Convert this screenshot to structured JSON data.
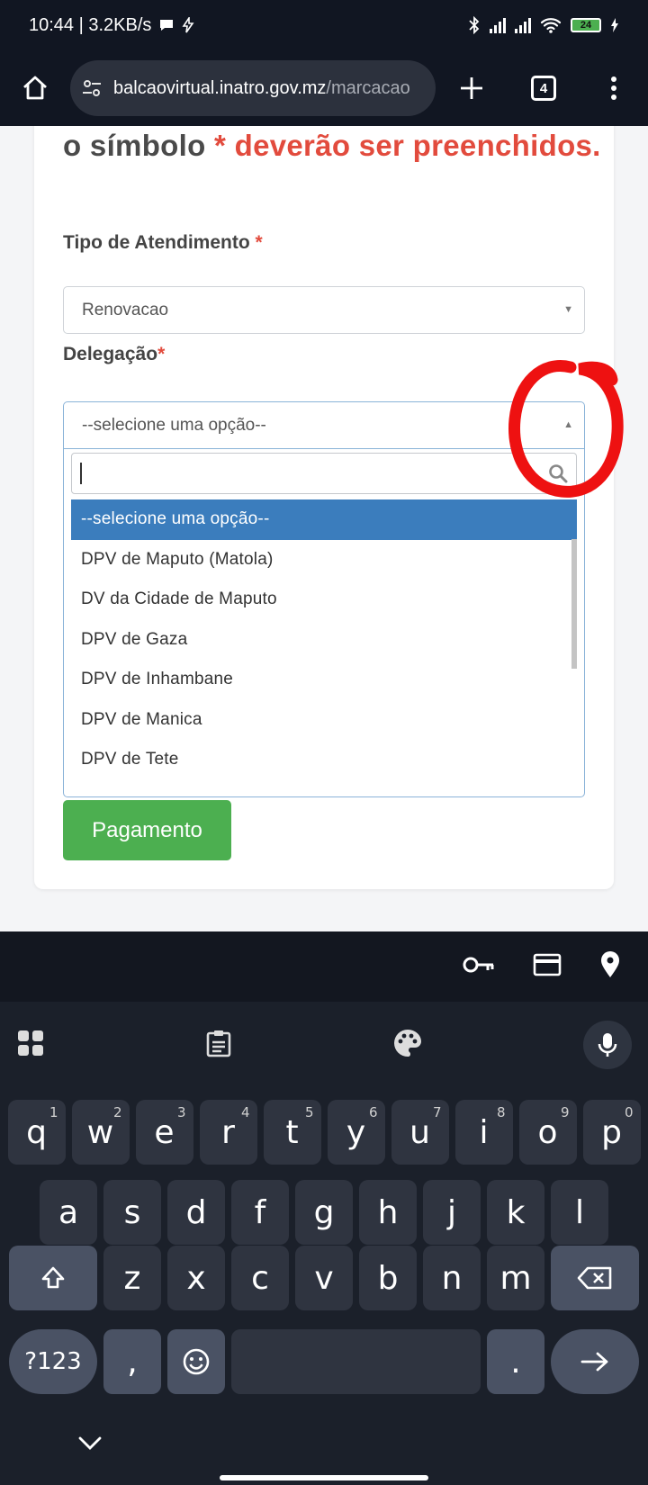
{
  "status_bar": {
    "time_speed": "10:44 | 3.2KB/s",
    "battery_level": "24"
  },
  "browser": {
    "url_host": "balcaovirtual.inatro.gov.mz",
    "url_path": "/marcacao",
    "tab_count": "4"
  },
  "form": {
    "notice_prefix": "o símbolo ",
    "notice_required": "* deverão ser preenchidos.",
    "tipo_label": "Tipo de Atendimento",
    "tipo_required_mark": "*",
    "tipo_value": "Renovacao",
    "delegacao_label": "Delegação",
    "delegacao_required_mark": "*",
    "delegacao_value": "--selecione uma opção--",
    "delegacao_options": [
      "--selecione uma opção--",
      "DPV de Maputo (Matola)",
      "DV da Cidade de Maputo",
      "DPV de Gaza",
      "DPV de Inhambane",
      "DPV de Manica",
      "DPV de Tete"
    ],
    "selected_option_index": 0,
    "submit_label": "Pagamento"
  },
  "keyboard": {
    "row1": [
      {
        "key": "q",
        "hint": "1"
      },
      {
        "key": "w",
        "hint": "2"
      },
      {
        "key": "e",
        "hint": "3"
      },
      {
        "key": "r",
        "hint": "4"
      },
      {
        "key": "t",
        "hint": "5"
      },
      {
        "key": "y",
        "hint": "6"
      },
      {
        "key": "u",
        "hint": "7"
      },
      {
        "key": "i",
        "hint": "8"
      },
      {
        "key": "o",
        "hint": "9"
      },
      {
        "key": "p",
        "hint": "0"
      }
    ],
    "row2": [
      "a",
      "s",
      "d",
      "f",
      "g",
      "h",
      "j",
      "k",
      "l"
    ],
    "row3": [
      "z",
      "x",
      "c",
      "v",
      "b",
      "n",
      "m"
    ],
    "symbols_label": "?123",
    "comma_label": ",",
    "period_label": "."
  },
  "colors": {
    "required_red": "#e24b3d",
    "selected_option_blue": "#3b7dbd",
    "submit_green": "#4caf50",
    "annotation_red": "#ee1111"
  }
}
